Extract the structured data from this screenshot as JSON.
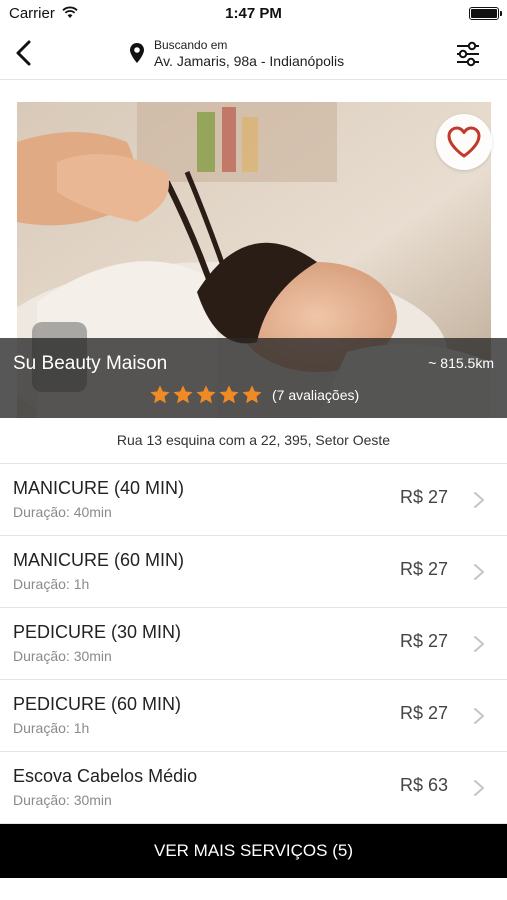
{
  "status_bar": {
    "carrier": "Carrier",
    "time": "1:47 PM"
  },
  "nav": {
    "location_caption": "Buscando em",
    "location_address": "Av. Jamaris, 98a - Indianópolis",
    "back_icon": "chevron-left-icon",
    "filter_icon": "sliders-icon",
    "location_icon": "map-pin-icon"
  },
  "salon": {
    "name": "Su Beauty Maison",
    "distance": "~ 815.5km",
    "rating": 5,
    "rating_max": 5,
    "reviews_label": "(7 avaliações)",
    "address": "Rua 13 esquina com a 22, 395, Setor Oeste",
    "favorite_icon": "heart-outline-icon"
  },
  "colors": {
    "star": "#f08a24",
    "favorite": "#c0392b",
    "button_bg": "#000000"
  },
  "services": [
    {
      "name": "MANICURE (40 MIN)",
      "duration": "Duração: 40min",
      "price": "R$ 27"
    },
    {
      "name": "MANICURE (60 MIN)",
      "duration": "Duração: 1h",
      "price": "R$ 27"
    },
    {
      "name": "PEDICURE (30 MIN)",
      "duration": "Duração: 30min",
      "price": "R$ 27"
    },
    {
      "name": "PEDICURE (60 MIN)",
      "duration": "Duração: 1h",
      "price": "R$ 27"
    },
    {
      "name": "Escova Cabelos Médio",
      "duration": "Duração: 30min",
      "price": "R$ 63"
    }
  ],
  "more_button": {
    "label": "VER MAIS SERVIÇOS (5)"
  }
}
